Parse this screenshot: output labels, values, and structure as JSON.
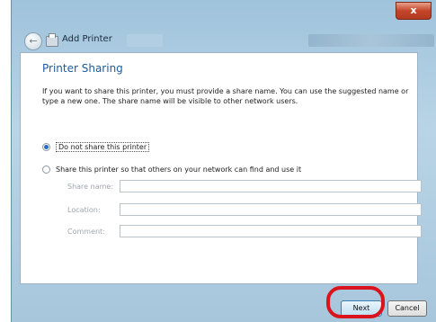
{
  "window": {
    "title": "Add Printer",
    "close_label": "x"
  },
  "page": {
    "heading": "Printer Sharing",
    "description": "If you want to share this printer, you must provide a share name. You can use the suggested name or type a new one. The share name will be visible to other network users."
  },
  "sharing": {
    "option_no_share": "Do not share this printer",
    "option_share": "Share this printer so that others on your network can find and use it",
    "selected": "no_share"
  },
  "fields": {
    "share_name_label": "Share name:",
    "share_name_value": "",
    "location_label": "Location:",
    "location_value": "",
    "comment_label": "Comment:",
    "comment_value": ""
  },
  "footer": {
    "next_label": "Next",
    "cancel_label": "Cancel"
  },
  "colors": {
    "heading": "#1e5a9a",
    "highlight": "#d9141c"
  }
}
